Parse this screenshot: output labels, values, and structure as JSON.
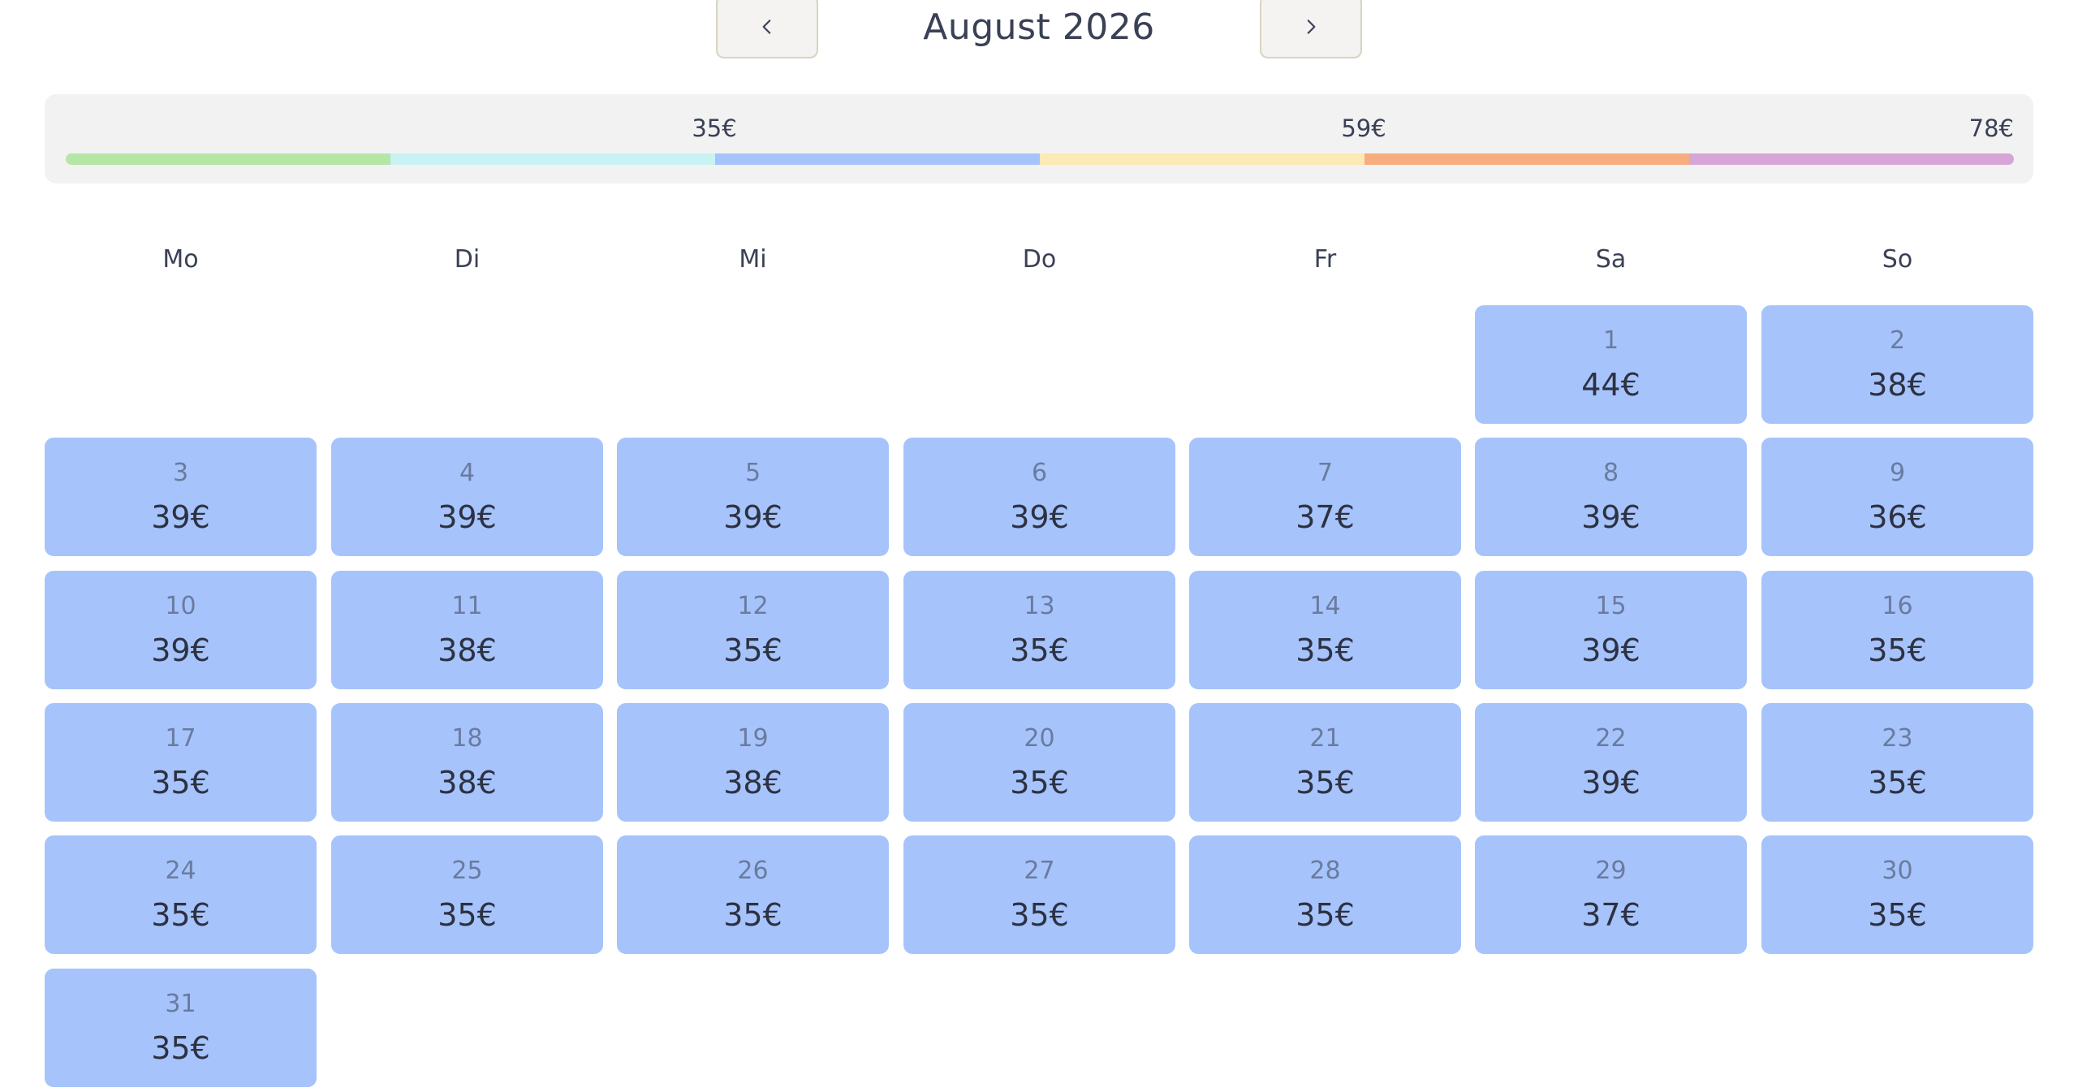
{
  "header": {
    "month_title": "August 2026",
    "prev_icon": "chevron-left-icon",
    "next_icon": "chevron-right-icon"
  },
  "legend": {
    "labels": [
      "35€",
      "59€",
      "78€"
    ],
    "segments": [
      "#b6e6a6",
      "#c8f3f2",
      "#a6c4fb",
      "#fbe9b6",
      "#f7ad7e",
      "#d7a5d8"
    ]
  },
  "weekdays": [
    "Mo",
    "Di",
    "Mi",
    "Do",
    "Fr",
    "Sa",
    "So"
  ],
  "first_weekday_index": 5,
  "days": [
    {
      "day": "1",
      "price": "44€"
    },
    {
      "day": "2",
      "price": "38€"
    },
    {
      "day": "3",
      "price": "39€"
    },
    {
      "day": "4",
      "price": "39€"
    },
    {
      "day": "5",
      "price": "39€"
    },
    {
      "day": "6",
      "price": "39€"
    },
    {
      "day": "7",
      "price": "37€"
    },
    {
      "day": "8",
      "price": "39€"
    },
    {
      "day": "9",
      "price": "36€"
    },
    {
      "day": "10",
      "price": "39€"
    },
    {
      "day": "11",
      "price": "38€"
    },
    {
      "day": "12",
      "price": "35€"
    },
    {
      "day": "13",
      "price": "35€"
    },
    {
      "day": "14",
      "price": "35€"
    },
    {
      "day": "15",
      "price": "39€"
    },
    {
      "day": "16",
      "price": "35€"
    },
    {
      "day": "17",
      "price": "35€"
    },
    {
      "day": "18",
      "price": "38€"
    },
    {
      "day": "19",
      "price": "38€"
    },
    {
      "day": "20",
      "price": "35€"
    },
    {
      "day": "21",
      "price": "35€"
    },
    {
      "day": "22",
      "price": "39€"
    },
    {
      "day": "23",
      "price": "35€"
    },
    {
      "day": "24",
      "price": "35€"
    },
    {
      "day": "25",
      "price": "35€"
    },
    {
      "day": "26",
      "price": "35€"
    },
    {
      "day": "27",
      "price": "35€"
    },
    {
      "day": "28",
      "price": "35€"
    },
    {
      "day": "29",
      "price": "37€"
    },
    {
      "day": "30",
      "price": "35€"
    },
    {
      "day": "31",
      "price": "35€"
    }
  ],
  "colors": {
    "day_cell": "#a6c4fb",
    "nav_border": "#d8d4bf",
    "legend_panel": "#f2f2f2"
  }
}
